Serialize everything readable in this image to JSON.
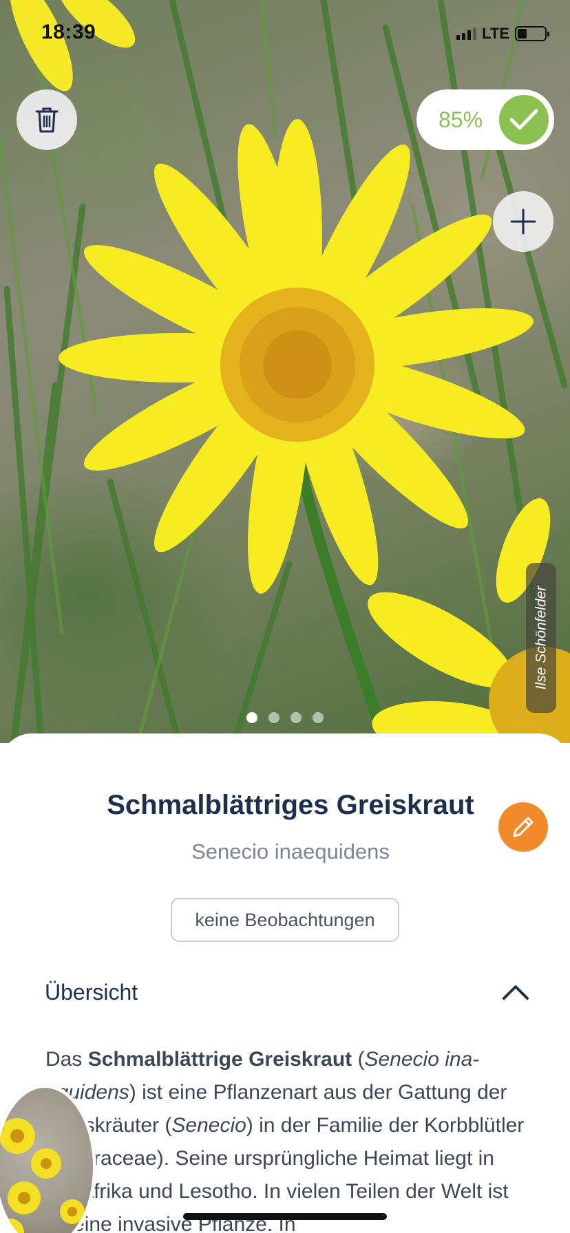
{
  "status_bar": {
    "time": "18:39",
    "network": "LTE",
    "battery_level": 0.35
  },
  "header": {
    "confidence": "85%",
    "photo_credit": "Ilse Schönfelder",
    "gallery": {
      "count": 4,
      "active_index": 0
    }
  },
  "icons": {
    "trash": "trash-icon",
    "check": "checkmark-icon",
    "add": "plus-icon",
    "edit": "pencil-icon",
    "collapse": "chevron-up-icon"
  },
  "colors": {
    "accent_green": "#8cc152",
    "edit_orange": "#f08a2a",
    "title_navy": "#1e2f4d"
  },
  "plant": {
    "common_name": "Schmalblättriges Greiskraut",
    "scientific_name": "Senecio inaequidens",
    "observations_label": "keine Beobachtungen"
  },
  "overview": {
    "heading": "Übersicht",
    "segments": [
      {
        "text": "Das ",
        "style": "normal"
      },
      {
        "text": "Schmalblättrige Greiskraut",
        "style": "bold"
      },
      {
        "text": " (",
        "style": "normal"
      },
      {
        "text": "Senecio ina­equidens",
        "style": "italic"
      },
      {
        "text": ") ist eine Pflanzenart aus der Gattung der Greiskräuter (",
        "style": "normal"
      },
      {
        "text": "Senecio",
        "style": "italic"
      },
      {
        "text": ") in der Familie der Korbblütler (Asteraceae). Seine ursprüngliche Heimat liegt in Südafrika und Lesotho. In vielen Teilen der Welt ist es eine invasive Pflanze. In",
        "style": "normal"
      }
    ]
  }
}
